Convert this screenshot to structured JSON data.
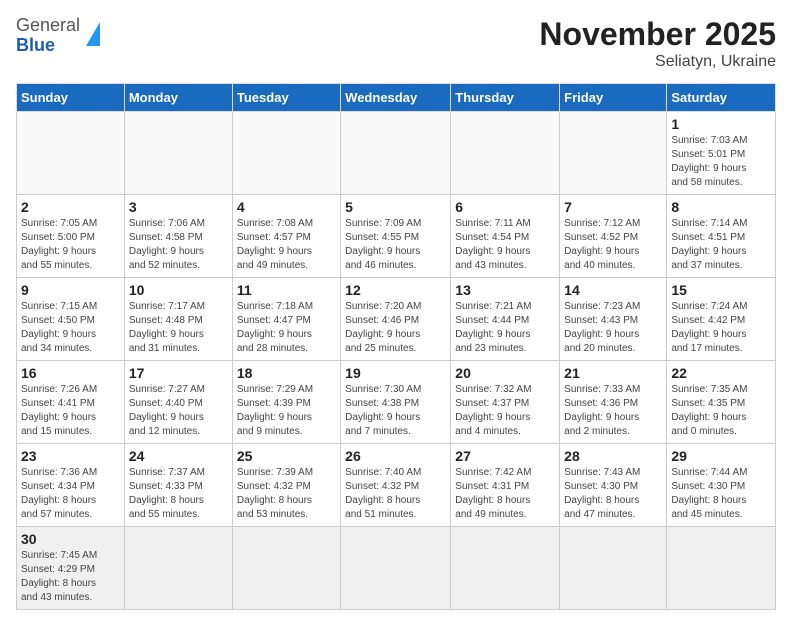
{
  "logo": {
    "general": "General",
    "blue": "Blue"
  },
  "title": "November 2025",
  "subtitle": "Seliatyn, Ukraine",
  "days_of_week": [
    "Sunday",
    "Monday",
    "Tuesday",
    "Wednesday",
    "Thursday",
    "Friday",
    "Saturday"
  ],
  "weeks": [
    [
      {
        "day": "",
        "info": ""
      },
      {
        "day": "",
        "info": ""
      },
      {
        "day": "",
        "info": ""
      },
      {
        "day": "",
        "info": ""
      },
      {
        "day": "",
        "info": ""
      },
      {
        "day": "",
        "info": ""
      },
      {
        "day": "1",
        "info": "Sunrise: 7:03 AM\nSunset: 5:01 PM\nDaylight: 9 hours\nand 58 minutes."
      }
    ],
    [
      {
        "day": "2",
        "info": "Sunrise: 7:05 AM\nSunset: 5:00 PM\nDaylight: 9 hours\nand 55 minutes."
      },
      {
        "day": "3",
        "info": "Sunrise: 7:06 AM\nSunset: 4:58 PM\nDaylight: 9 hours\nand 52 minutes."
      },
      {
        "day": "4",
        "info": "Sunrise: 7:08 AM\nSunset: 4:57 PM\nDaylight: 9 hours\nand 49 minutes."
      },
      {
        "day": "5",
        "info": "Sunrise: 7:09 AM\nSunset: 4:55 PM\nDaylight: 9 hours\nand 46 minutes."
      },
      {
        "day": "6",
        "info": "Sunrise: 7:11 AM\nSunset: 4:54 PM\nDaylight: 9 hours\nand 43 minutes."
      },
      {
        "day": "7",
        "info": "Sunrise: 7:12 AM\nSunset: 4:52 PM\nDaylight: 9 hours\nand 40 minutes."
      },
      {
        "day": "8",
        "info": "Sunrise: 7:14 AM\nSunset: 4:51 PM\nDaylight: 9 hours\nand 37 minutes."
      }
    ],
    [
      {
        "day": "9",
        "info": "Sunrise: 7:15 AM\nSunset: 4:50 PM\nDaylight: 9 hours\nand 34 minutes."
      },
      {
        "day": "10",
        "info": "Sunrise: 7:17 AM\nSunset: 4:48 PM\nDaylight: 9 hours\nand 31 minutes."
      },
      {
        "day": "11",
        "info": "Sunrise: 7:18 AM\nSunset: 4:47 PM\nDaylight: 9 hours\nand 28 minutes."
      },
      {
        "day": "12",
        "info": "Sunrise: 7:20 AM\nSunset: 4:46 PM\nDaylight: 9 hours\nand 25 minutes."
      },
      {
        "day": "13",
        "info": "Sunrise: 7:21 AM\nSunset: 4:44 PM\nDaylight: 9 hours\nand 23 minutes."
      },
      {
        "day": "14",
        "info": "Sunrise: 7:23 AM\nSunset: 4:43 PM\nDaylight: 9 hours\nand 20 minutes."
      },
      {
        "day": "15",
        "info": "Sunrise: 7:24 AM\nSunset: 4:42 PM\nDaylight: 9 hours\nand 17 minutes."
      }
    ],
    [
      {
        "day": "16",
        "info": "Sunrise: 7:26 AM\nSunset: 4:41 PM\nDaylight: 9 hours\nand 15 minutes."
      },
      {
        "day": "17",
        "info": "Sunrise: 7:27 AM\nSunset: 4:40 PM\nDaylight: 9 hours\nand 12 minutes."
      },
      {
        "day": "18",
        "info": "Sunrise: 7:29 AM\nSunset: 4:39 PM\nDaylight: 9 hours\nand 9 minutes."
      },
      {
        "day": "19",
        "info": "Sunrise: 7:30 AM\nSunset: 4:38 PM\nDaylight: 9 hours\nand 7 minutes."
      },
      {
        "day": "20",
        "info": "Sunrise: 7:32 AM\nSunset: 4:37 PM\nDaylight: 9 hours\nand 4 minutes."
      },
      {
        "day": "21",
        "info": "Sunrise: 7:33 AM\nSunset: 4:36 PM\nDaylight: 9 hours\nand 2 minutes."
      },
      {
        "day": "22",
        "info": "Sunrise: 7:35 AM\nSunset: 4:35 PM\nDaylight: 9 hours\nand 0 minutes."
      }
    ],
    [
      {
        "day": "23",
        "info": "Sunrise: 7:36 AM\nSunset: 4:34 PM\nDaylight: 8 hours\nand 57 minutes."
      },
      {
        "day": "24",
        "info": "Sunrise: 7:37 AM\nSunset: 4:33 PM\nDaylight: 8 hours\nand 55 minutes."
      },
      {
        "day": "25",
        "info": "Sunrise: 7:39 AM\nSunset: 4:32 PM\nDaylight: 8 hours\nand 53 minutes."
      },
      {
        "day": "26",
        "info": "Sunrise: 7:40 AM\nSunset: 4:32 PM\nDaylight: 8 hours\nand 51 minutes."
      },
      {
        "day": "27",
        "info": "Sunrise: 7:42 AM\nSunset: 4:31 PM\nDaylight: 8 hours\nand 49 minutes."
      },
      {
        "day": "28",
        "info": "Sunrise: 7:43 AM\nSunset: 4:30 PM\nDaylight: 8 hours\nand 47 minutes."
      },
      {
        "day": "29",
        "info": "Sunrise: 7:44 AM\nSunset: 4:30 PM\nDaylight: 8 hours\nand 45 minutes."
      }
    ],
    [
      {
        "day": "30",
        "info": "Sunrise: 7:45 AM\nSunset: 4:29 PM\nDaylight: 8 hours\nand 43 minutes."
      },
      {
        "day": "",
        "info": ""
      },
      {
        "day": "",
        "info": ""
      },
      {
        "day": "",
        "info": ""
      },
      {
        "day": "",
        "info": ""
      },
      {
        "day": "",
        "info": ""
      },
      {
        "day": "",
        "info": ""
      }
    ]
  ]
}
